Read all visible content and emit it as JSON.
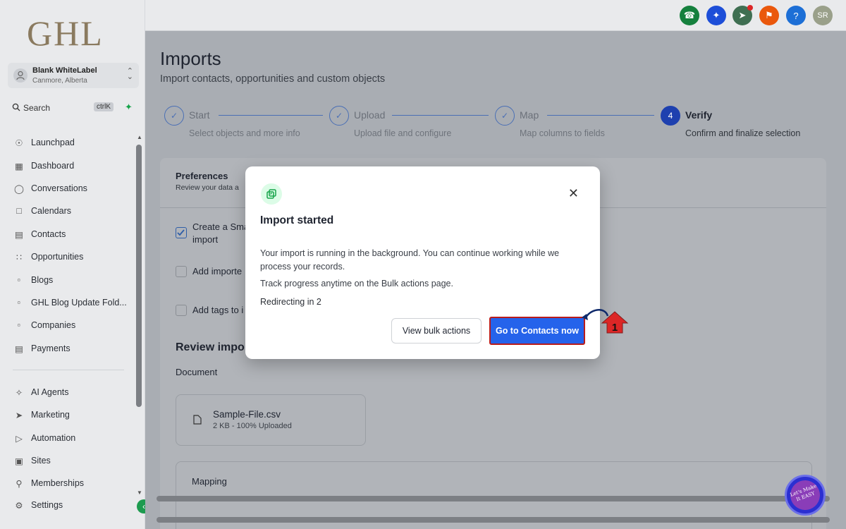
{
  "sidebar": {
    "logo": "GHL",
    "account": {
      "name": "Blank WhiteLabel",
      "location": "Canmore, Alberta"
    },
    "search": {
      "label": "Search",
      "shortcut": "ctrlK"
    },
    "items": [
      {
        "label": "Launchpad",
        "icon": "rocket-icon"
      },
      {
        "label": "Dashboard",
        "icon": "grid-icon"
      },
      {
        "label": "Conversations",
        "icon": "chat-icon"
      },
      {
        "label": "Calendars",
        "icon": "calendar-icon"
      },
      {
        "label": "Contacts",
        "icon": "contact-icon"
      },
      {
        "label": "Opportunities",
        "icon": "pipeline-icon"
      },
      {
        "label": "Blogs",
        "icon": "blog-icon"
      },
      {
        "label": "GHL Blog Update Fold...",
        "icon": "folder-icon"
      },
      {
        "label": "Companies",
        "icon": "building-icon"
      },
      {
        "label": "Payments",
        "icon": "payments-icon"
      },
      {
        "label": "AI Agents",
        "icon": "sparkle-icon"
      },
      {
        "label": "Marketing",
        "icon": "send-icon"
      },
      {
        "label": "Automation",
        "icon": "automation-icon"
      },
      {
        "label": "Sites",
        "icon": "sites-icon"
      },
      {
        "label": "Memberships",
        "icon": "membership-icon"
      },
      {
        "label": "Settings",
        "icon": "gear-icon"
      }
    ]
  },
  "topbar": {
    "icons": [
      {
        "name": "phone-icon",
        "color": "#15803d"
      },
      {
        "name": "magic-icon",
        "color": "#1d4ed8"
      },
      {
        "name": "megaphone-icon",
        "color": "#3f6f52"
      },
      {
        "name": "bell-icon",
        "color": "#ea580c"
      },
      {
        "name": "help-icon",
        "color": "#1d6fd6"
      }
    ],
    "avatar": "SR"
  },
  "page": {
    "title": "Imports",
    "subtitle": "Import contacts, opportunities and custom objects"
  },
  "steps": [
    {
      "label": "Start",
      "desc": "Select objects and more info",
      "state": "done"
    },
    {
      "label": "Upload",
      "desc": "Upload file and configure",
      "state": "done"
    },
    {
      "label": "Map",
      "desc": "Map columns to fields",
      "state": "done"
    },
    {
      "number": "4",
      "label": "Verify",
      "desc": "Confirm and finalize selection",
      "state": "active"
    }
  ],
  "preferences": {
    "title": "Preferences",
    "subtitle": "Review your data a",
    "options": [
      {
        "label": "Create a Sma\nimport",
        "checked": true
      },
      {
        "label": "Add importe",
        "checked": false
      },
      {
        "label": "Add tags to i",
        "checked": false
      }
    ]
  },
  "review": {
    "title": "Review impo",
    "document_label": "Document",
    "file": {
      "name": "Sample-File.csv",
      "status": "2 KB - 100% Uploaded"
    },
    "mapping_label": "Mapping"
  },
  "modal": {
    "title": "Import started",
    "body": "Your import is running in the background. You can continue working while we process your records.",
    "track": "Track progress anytime on the Bulk actions page.",
    "redirect": "Redirecting in 2",
    "secondary_button": "View bulk actions",
    "primary_button": "Go to Contacts now"
  },
  "annotation": {
    "number": "1"
  },
  "watermark": {
    "text": "Let's Make It EASY"
  },
  "colors": {
    "primary": "#2563eb",
    "active_step": "#1e40af",
    "highlight_border": "#b91c1c",
    "success": "#16a34a"
  }
}
